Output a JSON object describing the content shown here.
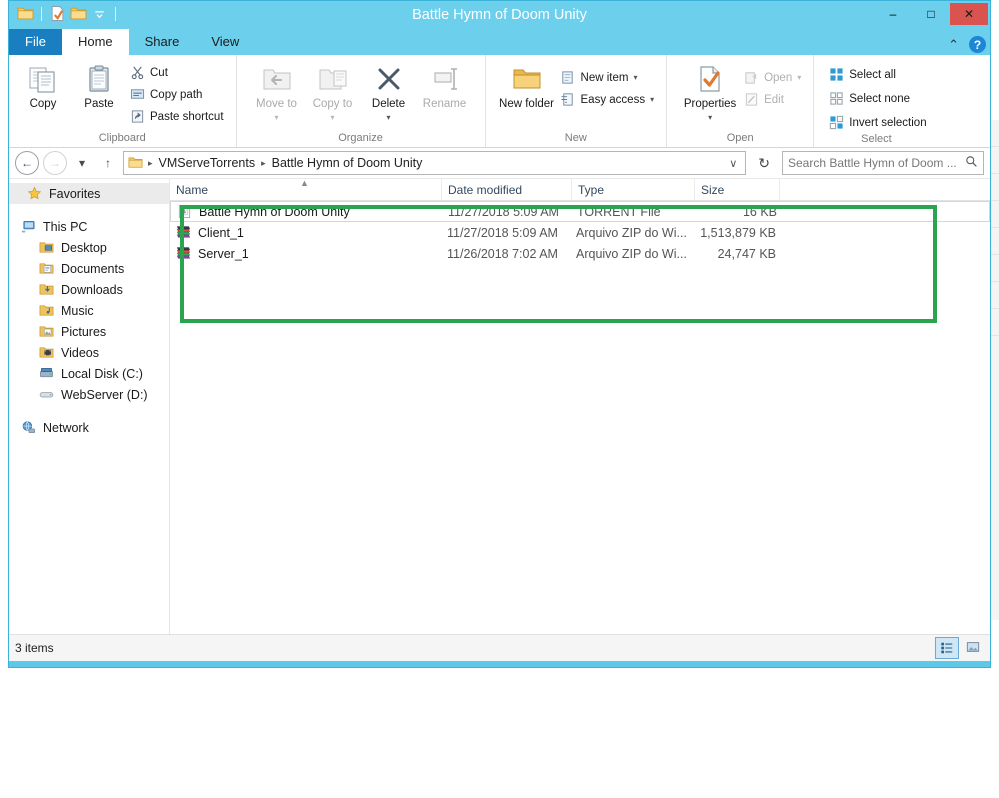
{
  "window": {
    "title": "Battle Hymn of Doom Unity",
    "minimize_label": "–",
    "maximize_label": "□",
    "close_label": "✕",
    "quick_access": [
      {
        "name": "folder-icon",
        "label": "Folder"
      },
      {
        "name": "properties-icon",
        "label": "Properties"
      },
      {
        "name": "new-folder-icon",
        "label": "New folder"
      },
      {
        "name": "customize-qat-dropdown-icon",
        "label": "▾"
      }
    ]
  },
  "ribbon": {
    "tabs": [
      {
        "label": "File",
        "state": "file"
      },
      {
        "label": "Home",
        "state": "active"
      },
      {
        "label": "Share",
        "state": "inactive"
      },
      {
        "label": "View",
        "state": "inactive"
      }
    ],
    "collapse_label": "⌃",
    "help_label": "?",
    "groups": [
      {
        "label": "Clipboard",
        "big_buttons": [
          {
            "label": "Copy",
            "icon": "copy-icon",
            "disabled": false
          },
          {
            "label": "Paste",
            "icon": "paste-icon",
            "disabled": false
          }
        ],
        "small_buttons": [
          {
            "label": "Cut",
            "icon": "scissors-icon",
            "disabled": false
          },
          {
            "label": "Copy path",
            "icon": "copy-path-icon",
            "disabled": false
          },
          {
            "label": "Paste shortcut",
            "icon": "paste-shortcut-icon",
            "disabled": false
          }
        ]
      },
      {
        "label": "Organize",
        "big_buttons": [
          {
            "label": "Move to",
            "icon": "move-to-icon",
            "disabled": true,
            "caret": "▾"
          },
          {
            "label": "Copy to",
            "icon": "copy-to-icon",
            "disabled": true,
            "caret": "▾"
          },
          {
            "label": "Delete",
            "icon": "delete-icon",
            "disabled": false,
            "caret": "▾"
          },
          {
            "label": "Rename",
            "icon": "rename-icon",
            "disabled": true
          }
        ]
      },
      {
        "label": "New",
        "big_buttons": [
          {
            "label": "New folder",
            "icon": "new-folder-icon",
            "disabled": false
          }
        ],
        "small_buttons": [
          {
            "label": "New item",
            "icon": "new-item-icon",
            "disabled": false,
            "caret": "▾"
          },
          {
            "label": "Easy access",
            "icon": "easy-access-icon",
            "disabled": false,
            "caret": "▾"
          }
        ]
      },
      {
        "label": "Open",
        "big_buttons": [
          {
            "label": "Properties",
            "icon": "properties-icon",
            "disabled": false,
            "caret": "▾"
          }
        ],
        "small_buttons": [
          {
            "label": "Open",
            "icon": "open-icon",
            "disabled": true,
            "caret": "▾"
          },
          {
            "label": "Edit",
            "icon": "edit-icon",
            "disabled": true
          }
        ]
      },
      {
        "label": "Select",
        "small_buttons": [
          {
            "label": "Select all",
            "icon": "select-all-icon",
            "disabled": false
          },
          {
            "label": "Select none",
            "icon": "select-none-icon",
            "disabled": false
          },
          {
            "label": "Invert selection",
            "icon": "invert-selection-icon",
            "disabled": false
          }
        ]
      }
    ]
  },
  "address": {
    "back_label": "←",
    "forward_label": "→",
    "recent_label": "▾",
    "up_label": "↑",
    "refresh_label": "↻",
    "dropdown_label": "∨",
    "breadcrumbs": [
      "VMServeTorrents",
      "Battle Hymn of Doom Unity"
    ],
    "separator": "▸"
  },
  "search": {
    "placeholder": "Search Battle Hymn of Doom ...",
    "icon": "search-icon"
  },
  "sidebar": {
    "items": [
      {
        "label": "Favorites",
        "icon": "star-icon",
        "level": "header"
      },
      {
        "label": "This PC",
        "icon": "computer-icon",
        "level": "group"
      },
      {
        "label": "Desktop",
        "icon": "desktop-folder-icon",
        "level": "child"
      },
      {
        "label": "Documents",
        "icon": "documents-folder-icon",
        "level": "child"
      },
      {
        "label": "Downloads",
        "icon": "downloads-folder-icon",
        "level": "child"
      },
      {
        "label": "Music",
        "icon": "music-folder-icon",
        "level": "child"
      },
      {
        "label": "Pictures",
        "icon": "pictures-folder-icon",
        "level": "child"
      },
      {
        "label": "Videos",
        "icon": "videos-folder-icon",
        "level": "child"
      },
      {
        "label": "Local Disk (C:)",
        "icon": "hard-drive-icon",
        "level": "child"
      },
      {
        "label": "WebServer (D:)",
        "icon": "drive-icon",
        "level": "child"
      },
      {
        "label": "Network",
        "icon": "network-icon",
        "level": "group"
      }
    ]
  },
  "filelist": {
    "columns": [
      {
        "label": "Name",
        "key": "name",
        "sorted": true,
        "sort_mark": "▲"
      },
      {
        "label": "Date modified",
        "key": "date"
      },
      {
        "label": "Type",
        "key": "type"
      },
      {
        "label": "Size",
        "key": "size"
      }
    ],
    "rows": [
      {
        "name": "Battle Hymn of Doom Unity",
        "date": "11/27/2018 5:09 AM",
        "type": "TORRENT File",
        "size": "16 KB",
        "icon": "torrent-file-icon",
        "focused": true
      },
      {
        "name": "Client_1",
        "date": "11/27/2018 5:09 AM",
        "type": "Arquivo ZIP do Wi...",
        "size": "1,513,879 KB",
        "icon": "zip-archive-icon",
        "focused": false
      },
      {
        "name": "Server_1",
        "date": "11/26/2018 7:02 AM",
        "type": "Arquivo ZIP do Wi...",
        "size": "24,747 KB",
        "icon": "zip-archive-icon",
        "focused": false
      }
    ]
  },
  "annotation": {
    "color": "#27a martial"
  },
  "statusbar": {
    "item_count": "3 items",
    "views": [
      {
        "name": "details-view-button",
        "label": "details",
        "active": true
      },
      {
        "name": "large-icons-view-button",
        "label": "large icons",
        "active": false
      }
    ]
  },
  "colors": {
    "title_bar": "#6ccfec",
    "file_tab": "#1a7fc1",
    "close_button": "#d9534f",
    "annotation_green": "#2aa44f"
  }
}
